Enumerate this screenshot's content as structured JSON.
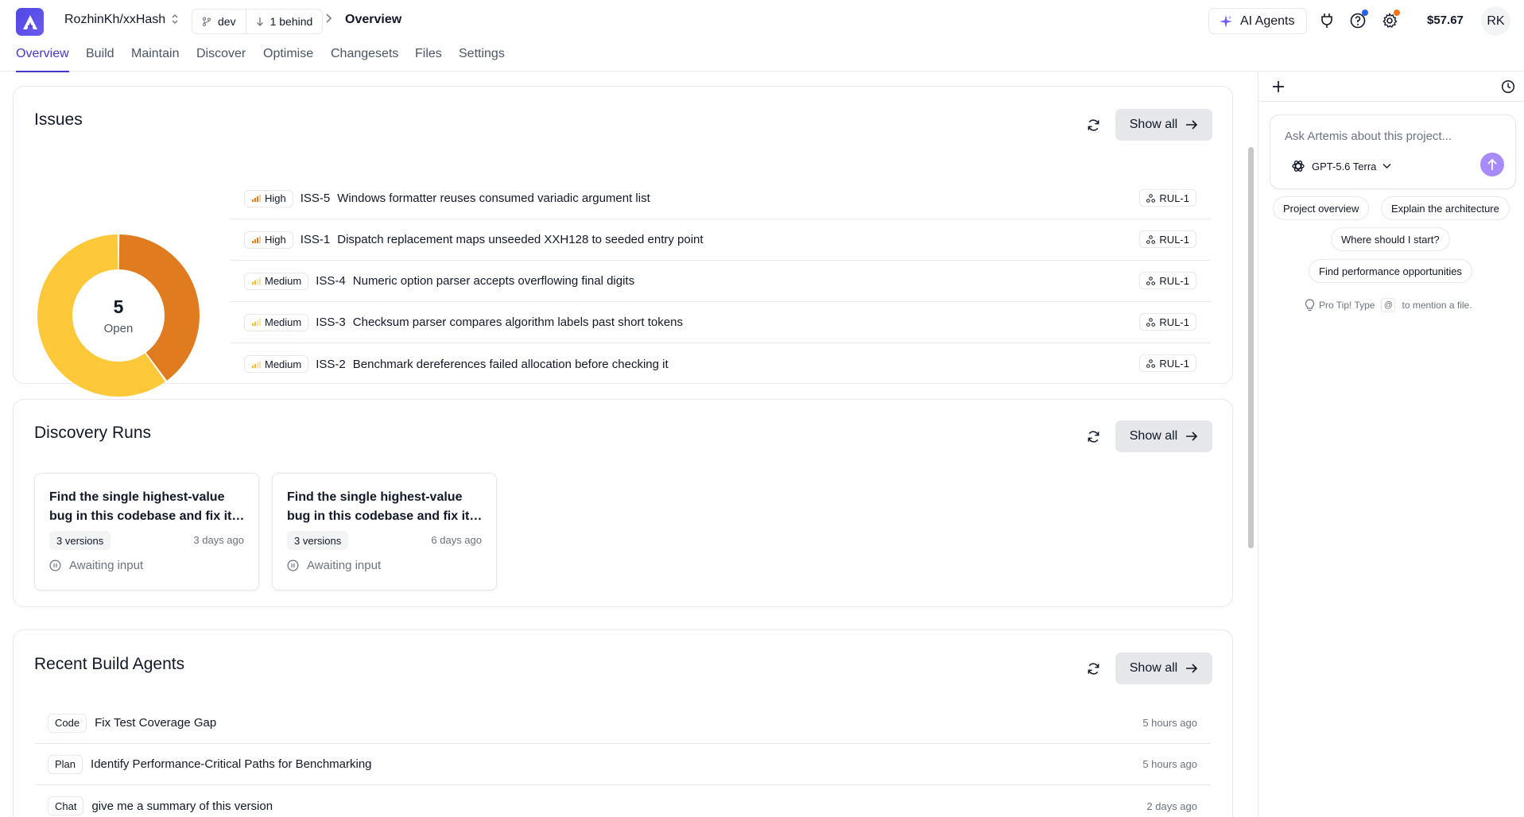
{
  "header": {
    "repo": "RozhinKh/xxHash",
    "branch": "dev",
    "behind": "1 behind",
    "breadcrumb_title": "Overview",
    "ai_agents_label": "AI Agents",
    "balance": "$57.67",
    "avatar_initials": "RK",
    "icons": [
      "app-logo-icon",
      "chevron-updown-icon",
      "git-branch-icon",
      "arrow-down-icon",
      "chevron-right-icon",
      "sparkle-icon",
      "plug-icon",
      "help-icon",
      "gear-icon"
    ],
    "colors": {
      "accent": "#4338ca",
      "notify_blue": "#2563eb",
      "notify_orange": "#f97316"
    }
  },
  "nav": {
    "tabs": [
      {
        "label": "Overview",
        "active": true
      },
      {
        "label": "Build"
      },
      {
        "label": "Maintain"
      },
      {
        "label": "Discover"
      },
      {
        "label": "Optimise"
      },
      {
        "label": "Changesets"
      },
      {
        "label": "Files"
      },
      {
        "label": "Settings"
      }
    ]
  },
  "issues": {
    "title": "Issues",
    "show_all": "Show all",
    "open_count": "5",
    "open_label": "Open",
    "severity_split": {
      "High": 2,
      "Medium": 3
    },
    "colors": {
      "high": "#e07b20",
      "medium": "#fdc93b"
    },
    "rows": [
      {
        "severity": "High",
        "id": "ISS-5",
        "title": "Windows formatter reuses consumed variadic argument list",
        "rule": "RUL-1"
      },
      {
        "severity": "High",
        "id": "ISS-1",
        "title": "Dispatch replacement maps unseeded XXH128 to seeded entry point",
        "rule": "RUL-1"
      },
      {
        "severity": "Medium",
        "id": "ISS-4",
        "title": "Numeric option parser accepts overflowing final digits",
        "rule": "RUL-1"
      },
      {
        "severity": "Medium",
        "id": "ISS-3",
        "title": "Checksum parser compares algorithm labels past short tokens",
        "rule": "RUL-1"
      },
      {
        "severity": "Medium",
        "id": "ISS-2",
        "title": "Benchmark dereferences failed allocation before checking it",
        "rule": "RUL-1"
      }
    ]
  },
  "discovery": {
    "title": "Discovery Runs",
    "show_all": "Show all",
    "runs": [
      {
        "title": "Find the single highest-value bug in this codebase and fix it…",
        "versions": "3 versions",
        "ago": "3 days ago",
        "status": "Awaiting input"
      },
      {
        "title": "Find the single highest-value bug in this codebase and fix it…",
        "versions": "3 versions",
        "ago": "6 days ago",
        "status": "Awaiting input"
      }
    ]
  },
  "build_agents": {
    "title": "Recent Build Agents",
    "show_all": "Show all",
    "rows": [
      {
        "kind": "Code",
        "title": "Fix Test Coverage Gap",
        "time": "5 hours ago"
      },
      {
        "kind": "Plan",
        "title": "Identify Performance-Critical Paths for Benchmarking",
        "time": "5 hours ago"
      },
      {
        "kind": "Chat",
        "title": "give me a summary of this version",
        "time": "2 days ago"
      }
    ]
  },
  "assistant": {
    "placeholder": "Ask Artemis about this project...",
    "model": "GPT-5.6 Terra",
    "suggestions": [
      "Project overview",
      "Explain the architecture",
      "Where should I start?",
      "Find performance opportunities"
    ],
    "protip_prefix": "Pro Tip! Type",
    "protip_key": "@",
    "protip_suffix": "to mention a file."
  }
}
